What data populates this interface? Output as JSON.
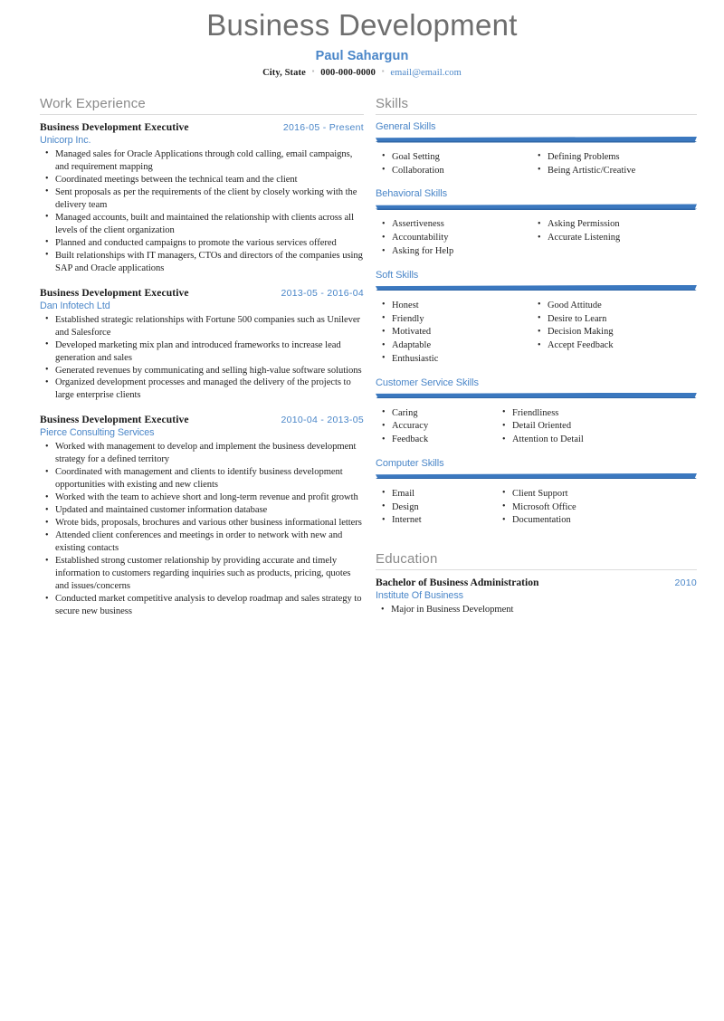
{
  "header": {
    "title": "Business Development",
    "name": "Paul Sahargun",
    "location": "City, State",
    "phone": "000-000-0000",
    "email": "email@email.com",
    "separator": "▪"
  },
  "theme": {
    "accent_blue": "#4a86c8",
    "bar_blue": "#3b78bf",
    "bar_blue_dark": "#2f66a6",
    "heading_gray": "#8a8a8a",
    "rule_gray": "#dcdcdc",
    "body_text": "#232323"
  },
  "work": {
    "section_title": "Work Experience",
    "entries": [
      {
        "role": "Business Development Executive",
        "date": "2016-05 - Present",
        "org": "Unicorp Inc.",
        "bullets": [
          "Managed sales for Oracle Applications through cold calling, email campaigns, and requirement mapping",
          "Coordinated meetings between the technical team and the client",
          "Sent proposals as per the requirements of the client by closely working with the delivery team",
          "Managed accounts, built and maintained the relationship with clients across all levels of the client organization",
          "Planned and conducted campaigns to promote the various services offered",
          "Built relationships with IT managers, CTOs and directors of the companies using SAP and Oracle applications"
        ]
      },
      {
        "role": "Business Development Executive",
        "date": "2013-05 - 2016-04",
        "org": "Dan Infotech Ltd",
        "bullets": [
          "Established strategic relationships with Fortune 500 companies such as Unilever and Salesforce",
          "Developed marketing mix plan and introduced frameworks to increase lead generation and sales",
          "Generated revenues by communicating and selling high-value software solutions",
          "Organized development processes and managed the delivery of the projects to large enterprise clients"
        ]
      },
      {
        "role": "Business Development Executive",
        "date": "2010-04 - 2013-05",
        "org": "Pierce Consulting Services",
        "bullets": [
          "Worked with management to develop and implement the business development strategy for a defined territory",
          "Coordinated with management and clients to identify business development opportunities with existing and new clients",
          "Worked with the team to achieve short and long-term revenue and profit growth",
          "Updated and maintained customer information database",
          "Wrote bids, proposals, brochures and various other business informational letters",
          "Attended client conferences and meetings in order to network with new and existing contacts",
          "Established strong customer relationship by providing accurate and timely information to customers regarding inquiries such as products, pricing, quotes and issues/concerns",
          "Conducted market competitive analysis to develop roadmap and sales strategy to secure new business"
        ]
      }
    ]
  },
  "skills": {
    "section_title": "Skills",
    "groups": [
      {
        "title": "General Skills",
        "narrow": false,
        "col_a": [
          "Goal Setting",
          "Collaboration"
        ],
        "col_b": [
          "Defining Problems",
          "Being Artistic/Creative"
        ]
      },
      {
        "title": "Behavioral Skills",
        "narrow": false,
        "col_a": [
          "Assertiveness",
          "Accountability",
          "Asking for Help"
        ],
        "col_b": [
          "Asking Permission",
          "Accurate Listening"
        ]
      },
      {
        "title": "Soft Skills",
        "narrow": false,
        "col_a": [
          "Honest",
          "Friendly",
          "Motivated",
          "Adaptable",
          "Enthusiastic"
        ],
        "col_b": [
          "Good Attitude",
          "Desire to Learn",
          "Decision Making",
          "Accept Feedback"
        ]
      },
      {
        "title": "Customer Service Skills",
        "narrow": true,
        "col_a": [
          "Caring",
          "Accuracy",
          "Feedback"
        ],
        "col_b": [
          "Friendliness",
          "Detail Oriented",
          "Attention to Detail"
        ]
      },
      {
        "title": "Computer Skills",
        "narrow": true,
        "col_a": [
          "Email",
          "Design",
          "Internet"
        ],
        "col_b": [
          "Client Support",
          "Microsoft Office",
          "Documentation"
        ]
      }
    ]
  },
  "education": {
    "section_title": "Education",
    "degree": "Bachelor of Business Administration",
    "year": "2010",
    "school": "Institute Of Business",
    "bullets": [
      "Major in Business Development"
    ]
  }
}
